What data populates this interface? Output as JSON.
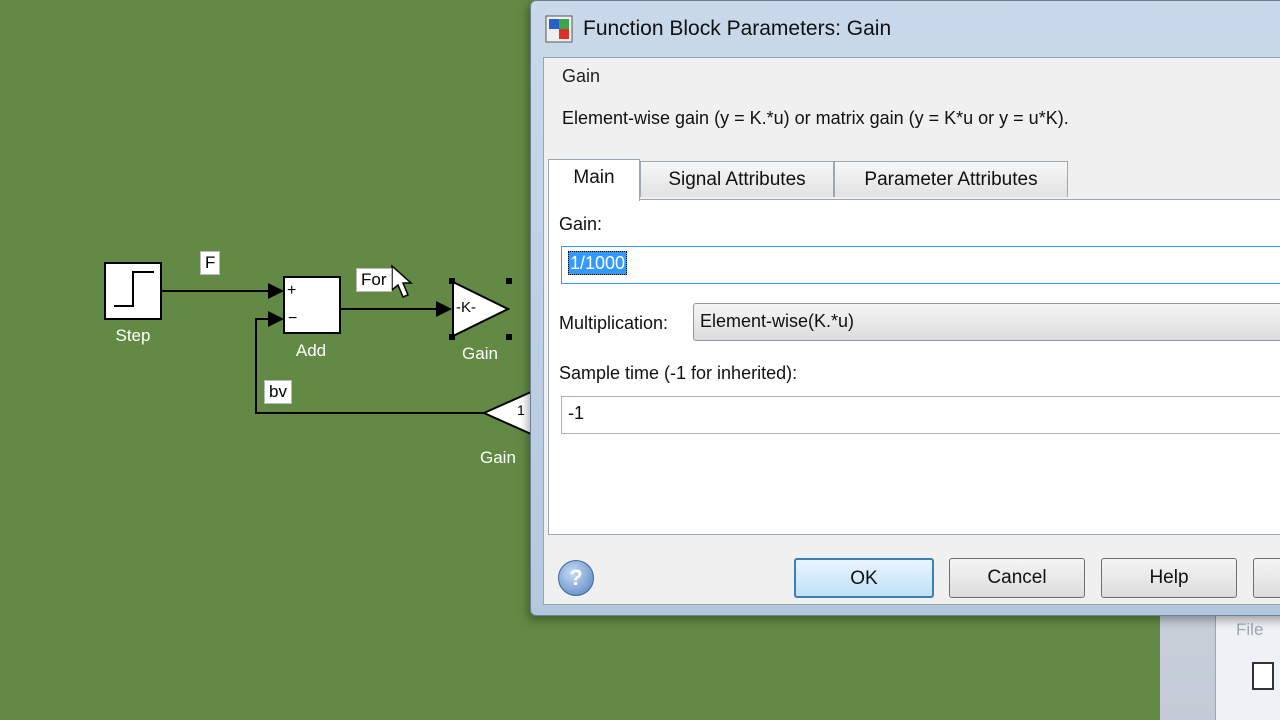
{
  "canvas": {
    "blocks": {
      "step_label": "Step",
      "add_label": "Add",
      "add_plus": "+",
      "add_minus": "−",
      "gain_label": "Gain",
      "gain_text": "-K-",
      "gain1_label": "Gain",
      "gain1_text": "1"
    },
    "signals": {
      "f_label": "F",
      "force_label": "For",
      "bv_label": "bv"
    }
  },
  "background_window": {
    "menu_file": "File"
  },
  "dialog": {
    "title": "Function Block Parameters: Gain",
    "group_title": "Gain",
    "description": "Element-wise gain (y = K.*u) or matrix gain (y = K*u or y = u*K).",
    "tabs": [
      {
        "label": "Main"
      },
      {
        "label": "Signal Attributes"
      },
      {
        "label": "Parameter Attributes"
      }
    ],
    "gain_label": "Gain:",
    "gain_value": "1/1000",
    "multiplication_label": "Multiplication:",
    "multiplication_value": "Element-wise(K.*u)",
    "sample_time_label": "Sample time (-1 for inherited):",
    "sample_time_value": "-1",
    "help_glyph": "?",
    "buttons": {
      "ok": "OK",
      "cancel": "Cancel",
      "help": "Help"
    }
  },
  "colors": {
    "canvas_bg": "#628a44",
    "selection": "#3399ff",
    "default_button_border": "#3c7fb1"
  }
}
